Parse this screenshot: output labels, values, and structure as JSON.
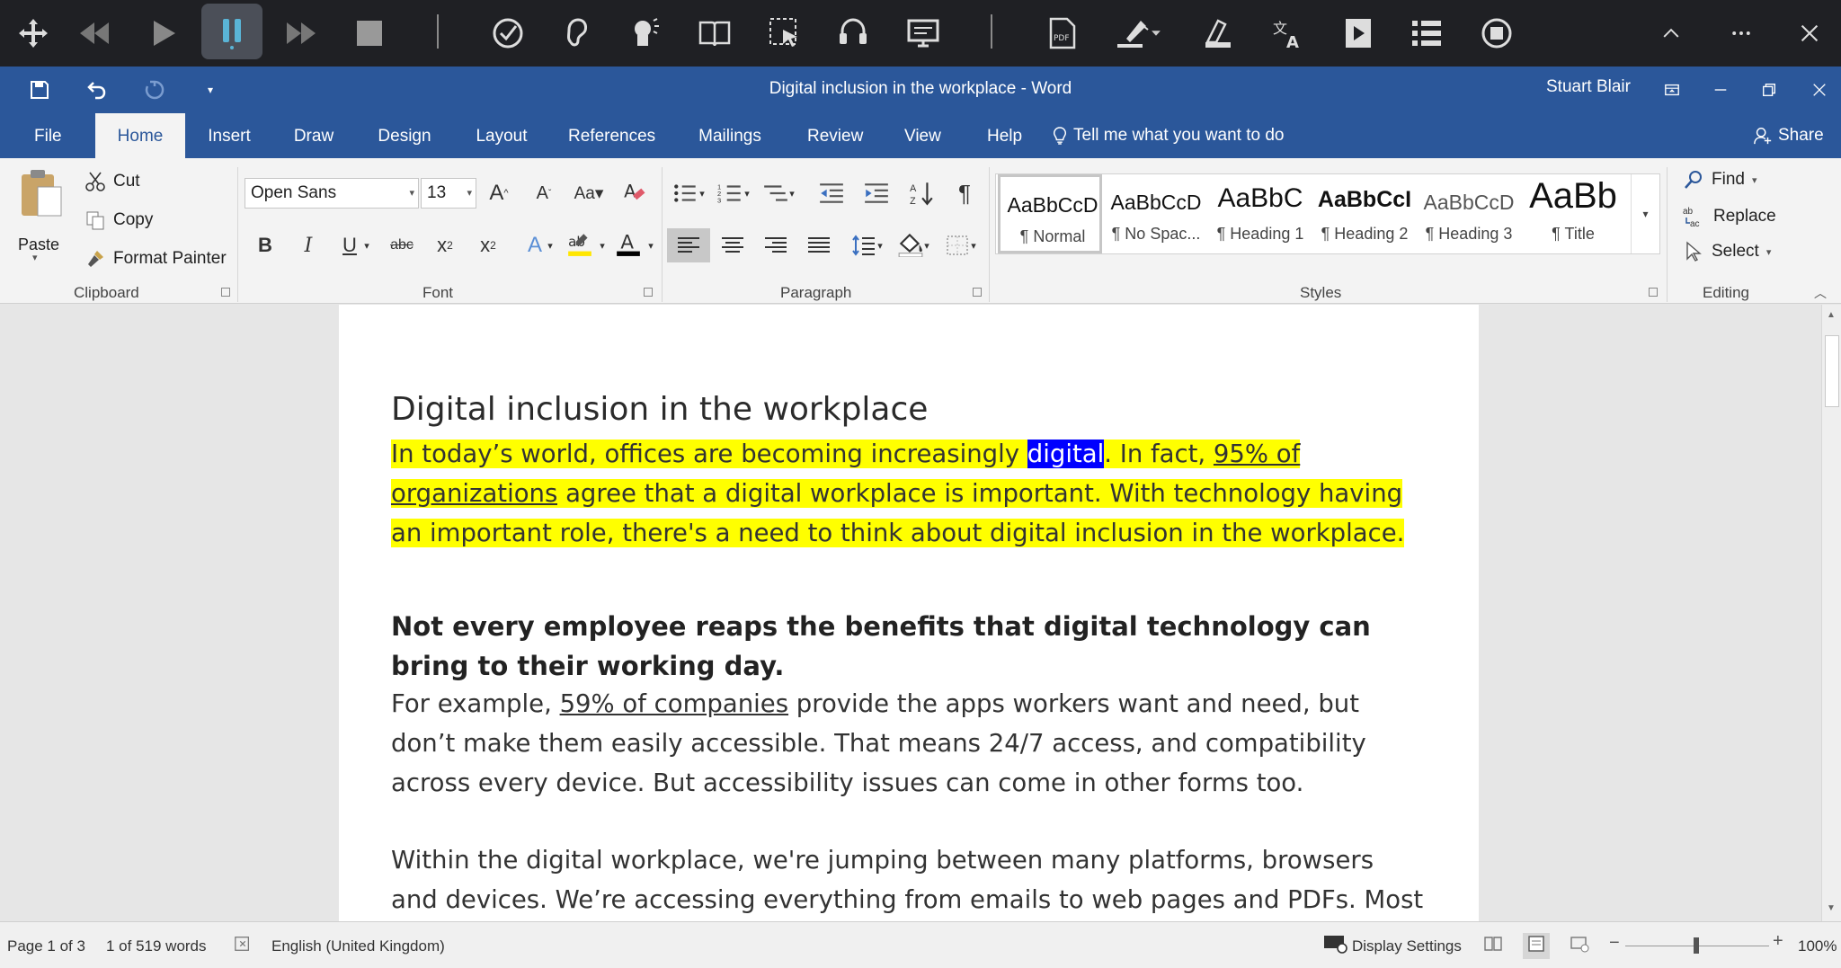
{
  "reader_toolbar": {
    "icons": [
      "move-icon",
      "rewind-icon",
      "play-icon",
      "pause-icon",
      "fast-forward-icon",
      "stop-icon",
      "check-icon",
      "ear-icon",
      "speaker-head-icon",
      "book-icon",
      "select-icon",
      "headset-icon",
      "screen-icon",
      "pdf-icon",
      "highlighter-icon",
      "scanner-icon",
      "translate-icon",
      "video-icon",
      "list-icon",
      "settings-icon",
      "collapse-icon",
      "more-icon",
      "close-icon"
    ]
  },
  "title_bar": {
    "doc_title": "Digital inclusion in the workplace  -  Word",
    "user": "Stuart Blair"
  },
  "tabs": [
    "File",
    "Home",
    "Insert",
    "Draw",
    "Design",
    "Layout",
    "References",
    "Mailings",
    "Review",
    "View",
    "Help"
  ],
  "tell_me": "Tell me what you want to do",
  "share": "Share",
  "clipboard": {
    "paste": "Paste",
    "cut": "Cut",
    "copy": "Copy",
    "format_painter": "Format Painter",
    "label": "Clipboard"
  },
  "font": {
    "family": "Open Sans",
    "size": "13",
    "label": "Font"
  },
  "paragraph": {
    "label": "Paragraph"
  },
  "styles": {
    "items": [
      {
        "sample": "AaBbCcD",
        "name": "¶ Normal"
      },
      {
        "sample": "AaBbCcD",
        "name": "¶ No Spac..."
      },
      {
        "sample": "AaBbC",
        "name": "¶ Heading 1"
      },
      {
        "sample": "AaBbCcI",
        "name": "¶ Heading 2"
      },
      {
        "sample": "AaBbCcD",
        "name": "¶ Heading 3"
      },
      {
        "sample": "AaBb",
        "name": "¶ Title"
      }
    ],
    "label": "Styles"
  },
  "editing": {
    "find": "Find",
    "replace": "Replace",
    "select": "Select",
    "label": "Editing"
  },
  "document": {
    "title": "Digital inclusion in the workplace",
    "p1_a": "In today’s world, offices are becoming increasingly ",
    "p1_sel": "digital",
    "p1_b": ". In fact, ",
    "p1_link": "95% of organizations",
    "p1_c": " agree that a digital workplace is important. With technology having an important role, there's a need to think about digital inclusion in the workplace.",
    "h2": "Not every employee reaps the benefits that digital technology can bring to their working day.",
    "p2_a": "For example, ",
    "p2_link": "59% of companies",
    "p2_b": " provide the apps workers want and need, but don’t make them easily accessible. That means 24/7 access, and compatibility across every device. But accessibility issues can come in other forms too.",
    "p3": "Within the digital workplace, we're jumping between many platforms, browsers and devices. We’re accessing everything from emails to web pages and PDFs. Most of the"
  },
  "status_bar": {
    "page": "Page 1 of 3",
    "words": "1 of 519 words",
    "language": "English (United Kingdom)",
    "display_settings": "Display Settings",
    "zoom": "100%"
  },
  "colors": {
    "word_blue": "#2b579a",
    "highlight": "#ffff00",
    "selection": "#0000ff",
    "reader_bar": "#1f2024"
  }
}
